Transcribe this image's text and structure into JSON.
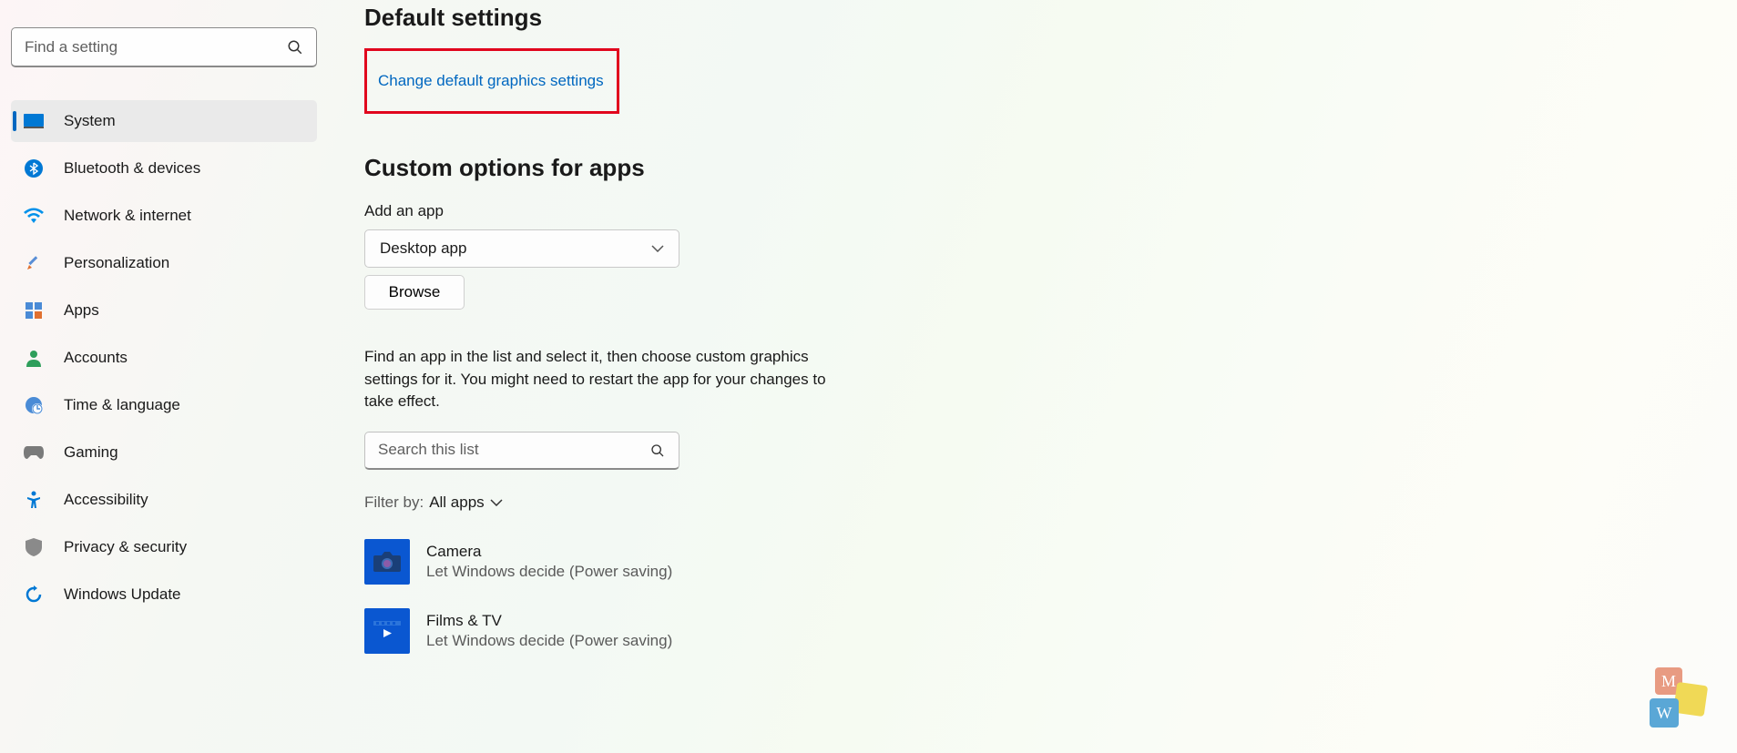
{
  "search": {
    "placeholder": "Find a setting"
  },
  "nav": [
    {
      "label": "System",
      "selected": true
    },
    {
      "label": "Bluetooth & devices",
      "selected": false
    },
    {
      "label": "Network & internet",
      "selected": false
    },
    {
      "label": "Personalization",
      "selected": false
    },
    {
      "label": "Apps",
      "selected": false
    },
    {
      "label": "Accounts",
      "selected": false
    },
    {
      "label": "Time & language",
      "selected": false
    },
    {
      "label": "Gaming",
      "selected": false
    },
    {
      "label": "Accessibility",
      "selected": false
    },
    {
      "label": "Privacy & security",
      "selected": false
    },
    {
      "label": "Windows Update",
      "selected": false
    }
  ],
  "section1": {
    "heading": "Default settings",
    "link": "Change default graphics settings"
  },
  "section2": {
    "heading": "Custom options for apps",
    "add_label": "Add an app",
    "dropdown_value": "Desktop app",
    "browse": "Browse",
    "help": "Find an app in the list and select it, then choose custom graphics settings for it. You might need to restart the app for your changes to take effect.",
    "search_placeholder": "Search this list",
    "filter_prefix": "Filter by:",
    "filter_value": "All apps"
  },
  "apps": [
    {
      "name": "Camera",
      "sub": "Let Windows decide (Power saving)"
    },
    {
      "name": "Films & TV",
      "sub": "Let Windows decide (Power saving)"
    }
  ]
}
